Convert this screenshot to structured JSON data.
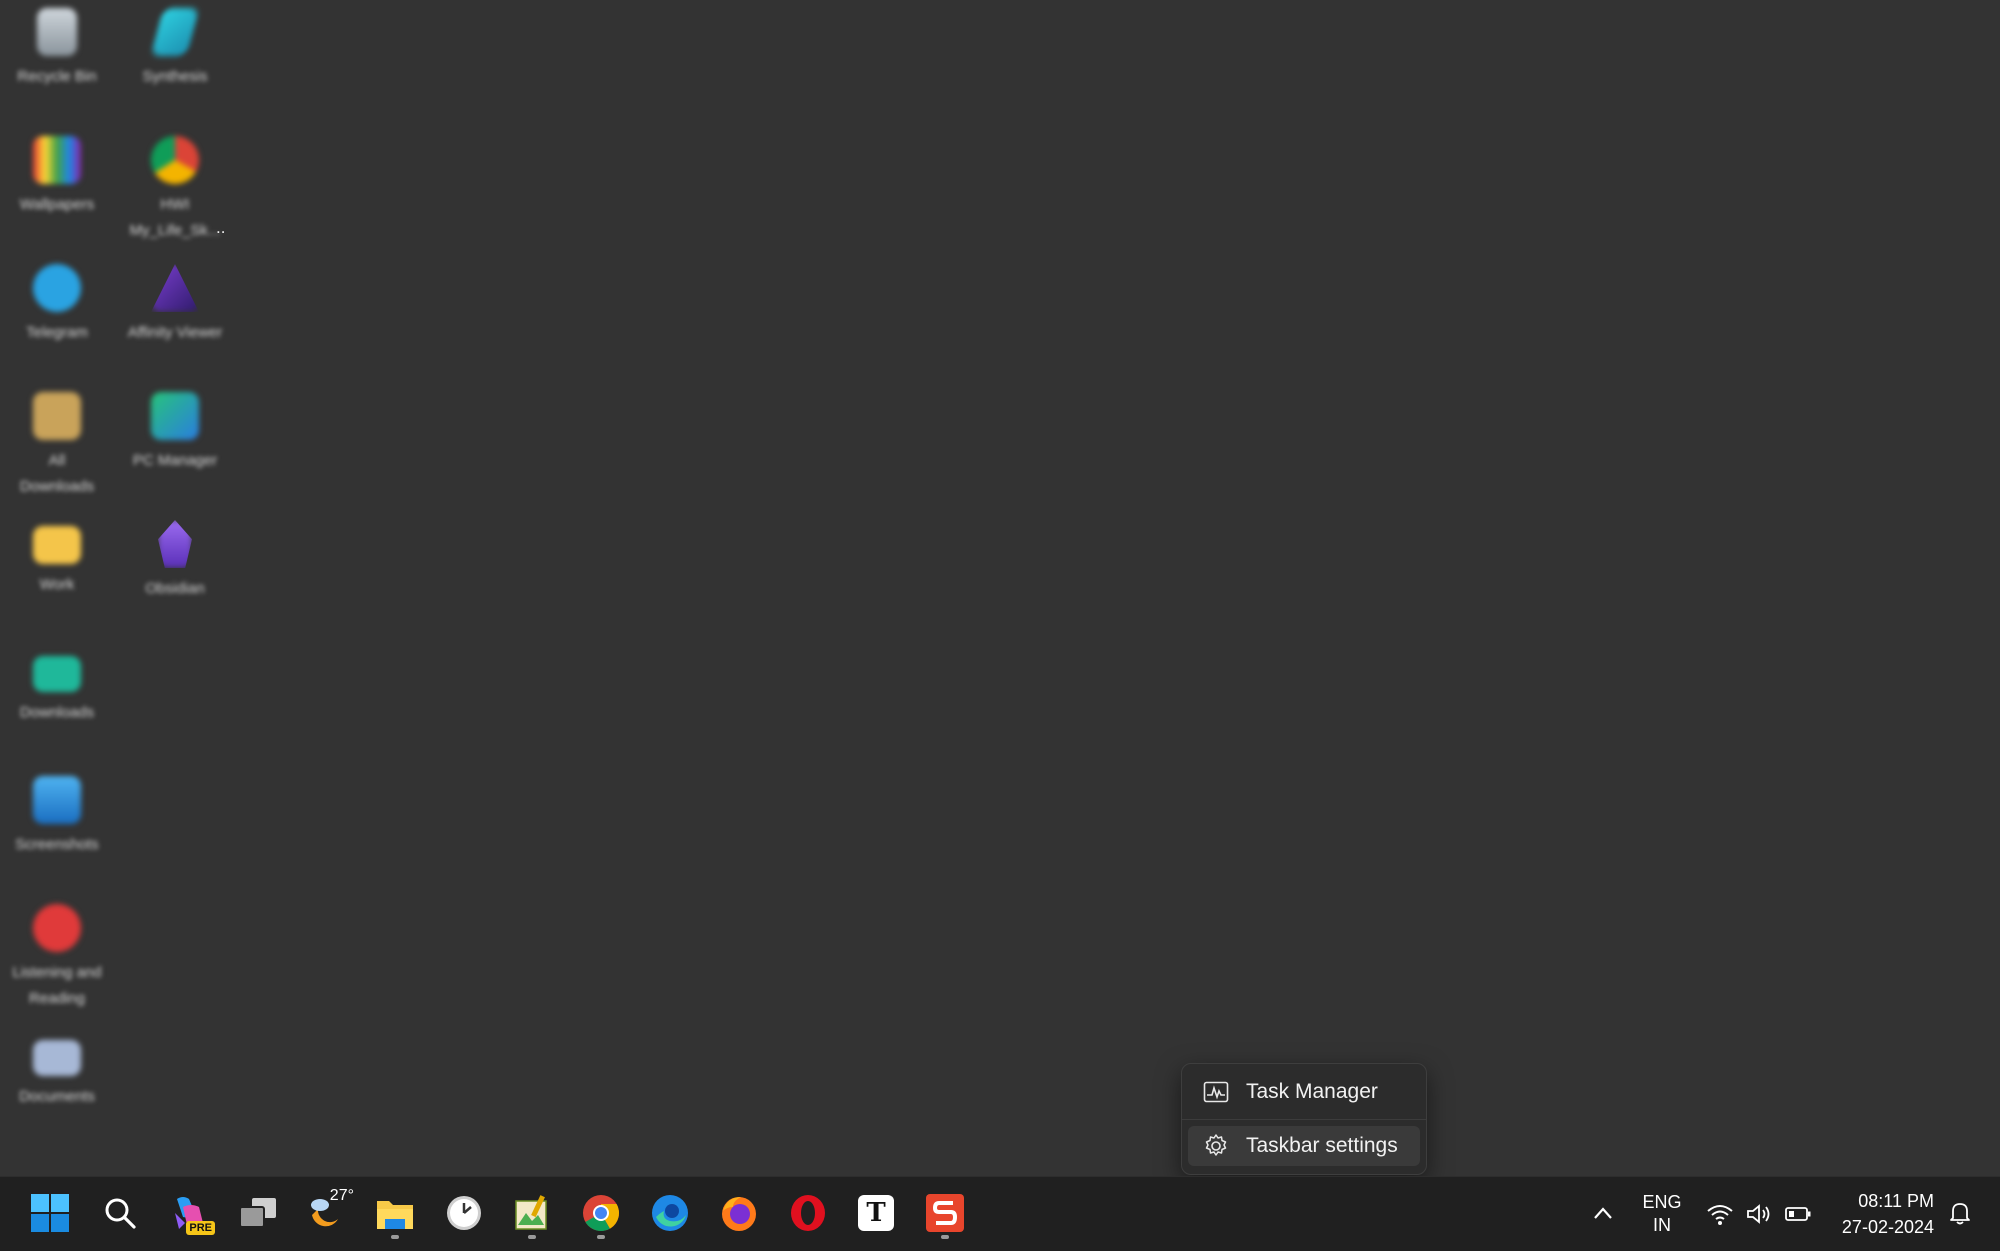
{
  "desktop": {
    "icons": [
      {
        "label": "Recycle Bin"
      },
      {
        "label": "Synthesis"
      },
      {
        "label": "Wallpapers"
      },
      {
        "label": "HWI\nMy_Life_Sk..."
      },
      {
        "label": "Telegram"
      },
      {
        "label": "Affinity Viewer"
      },
      {
        "label": "All\nDownloads"
      },
      {
        "label": "PC Manager"
      },
      {
        "label": "Work"
      },
      {
        "label": "Obsidian"
      },
      {
        "label": "Downloads"
      },
      {
        "label": "Screenshots"
      },
      {
        "label": "Listening and\nReading"
      },
      {
        "label": "Documents"
      }
    ],
    "stray_chars": [
      ".."
    ]
  },
  "context_menu": {
    "task_manager": "Task Manager",
    "taskbar_settings": "Taskbar settings"
  },
  "taskbar": {
    "weather_temp": "27°",
    "language_line1": "ENG",
    "language_line2": "IN",
    "time": "08:11 PM",
    "date": "27-02-2024",
    "copilot_badge": "PRE",
    "typora_letter": "T"
  },
  "colors": {
    "desktop_bg": "#333333",
    "taskbar_bg": "#202020",
    "menu_bg": "#2c2c2c",
    "windows_blue": "#0078d4"
  }
}
